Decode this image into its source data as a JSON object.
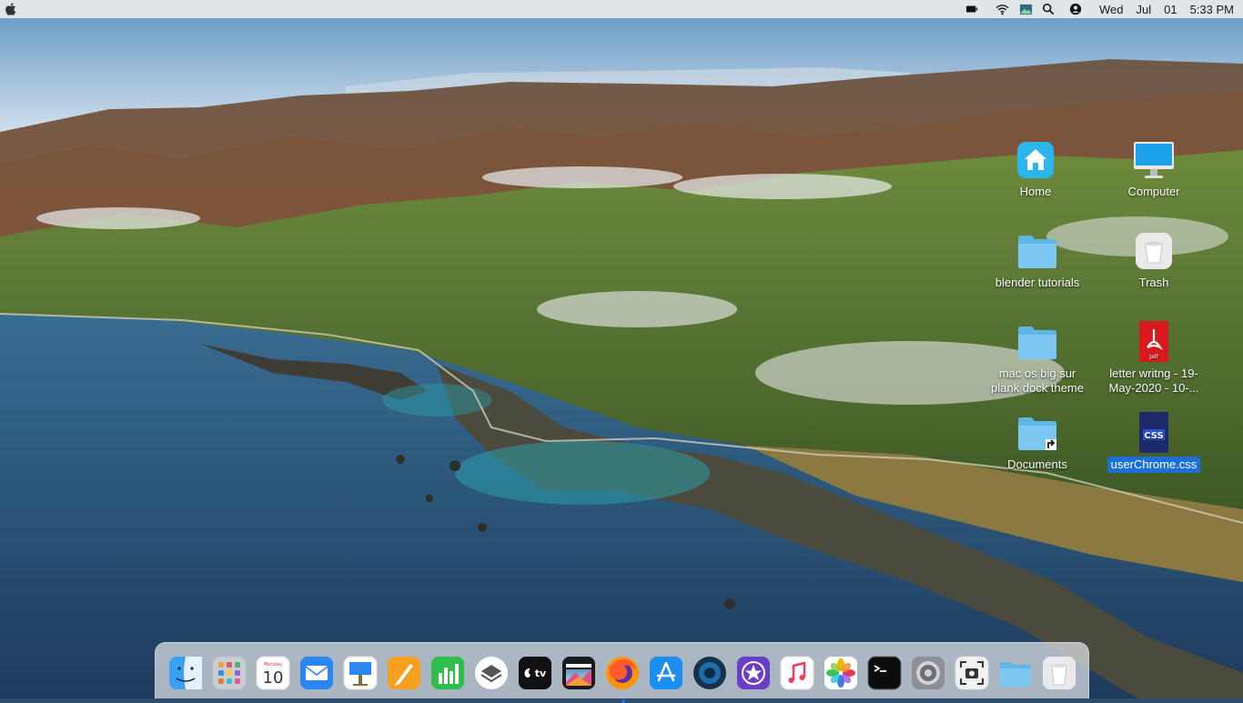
{
  "menubar": {
    "tray_icons": [
      "battery-icon",
      "wifi-icon",
      "photo-app-icon",
      "search-icon",
      "user-icon"
    ],
    "clock": {
      "day": "Wed",
      "month": "Jul",
      "date": "01",
      "time": "5:33 PM"
    }
  },
  "desktop": {
    "icons": {
      "home": "Home",
      "computer": "Computer",
      "blender": "blender tutorials",
      "trash": "Trash",
      "macos_line1": "mac os big sur",
      "macos_line2": "plank dock theme",
      "letter_line1": "letter writng - 19-",
      "letter_line2": "May-2020 - 10-...",
      "documents": "Documents",
      "userchrome": "userChrome.css"
    },
    "pdf_badge": "pdf",
    "css_badge": "CSS"
  },
  "dock": {
    "calendar_month": "Monday",
    "calendar_day": "10",
    "tv_label": "tv",
    "items": [
      "finder",
      "launchpad",
      "calendar",
      "mail",
      "keynote",
      "pages",
      "numbers",
      "layers",
      "apple-tv",
      "final-cut",
      "firefox",
      "app-store",
      "blue-circle",
      "imovie",
      "music",
      "photos",
      "terminal",
      "system-preferences",
      "screenshot",
      "folder",
      "trash"
    ]
  },
  "colors": {
    "accent": "#1c6fd6",
    "menubar": "#ececec",
    "folder": "#7cc8f2"
  }
}
